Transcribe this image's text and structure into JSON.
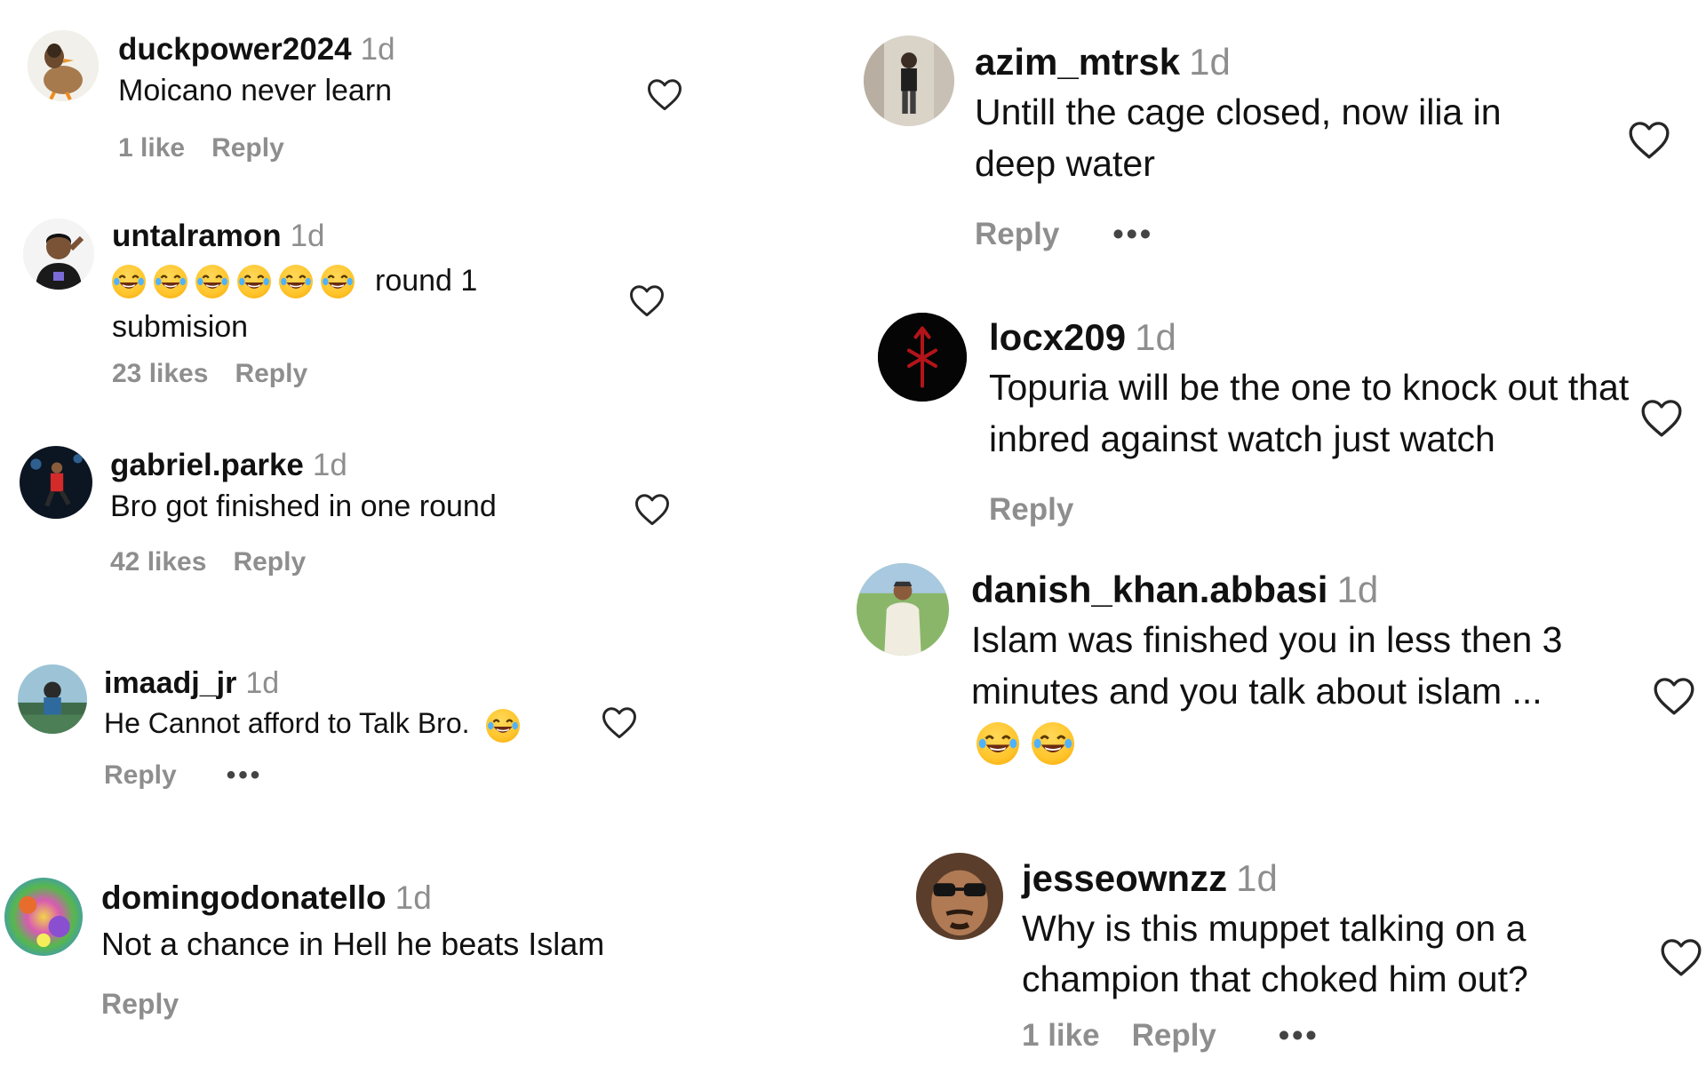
{
  "left_comments": [
    {
      "username": "duckpower2024",
      "time": "1d",
      "text": "Moicano never learn",
      "likes": "1 like",
      "reply": "Reply"
    },
    {
      "username": "untalramon",
      "time": "1d",
      "emoji_count": 6,
      "text_after_emoji": "round 1",
      "text_line2": "submision",
      "likes": "23 likes",
      "reply": "Reply"
    },
    {
      "username": "gabriel.parke",
      "time": "1d",
      "text": "Bro got finished in one round",
      "likes": "42 likes",
      "reply": "Reply"
    },
    {
      "username": "imaadj_jr",
      "time": "1d",
      "text": "He Cannot afford to Talk Bro.",
      "reply": "Reply",
      "more": "•••"
    },
    {
      "username": "domingodonatello",
      "time": "1d",
      "text": "Not a chance in Hell he beats Islam",
      "reply": "Reply"
    }
  ],
  "right_comments": [
    {
      "username": "azim_mtrsk",
      "time": "1d",
      "text": "Untill the cage closed, now ilia in deep water",
      "reply": "Reply",
      "more": "•••"
    },
    {
      "username": "locx209",
      "time": "1d",
      "text": "Topuria will be the one to knock out that inbred against watch just watch",
      "reply": "Reply"
    },
    {
      "username": "danish_khan.abbasi",
      "time": "1d",
      "text": "Islam was finished you in less then 3 minutes and you talk about islam ...",
      "emoji_count": 2
    },
    {
      "username": "jesseownzz",
      "time": "1d",
      "text": "Why is this muppet talking on a champion that choked him out?",
      "likes": "1 like",
      "reply": "Reply",
      "more": "•••"
    }
  ],
  "icons": {
    "like": "heart-outline-icon",
    "emoji": "face-with-tears-of-joy-icon",
    "more": "more-horizontal-icon"
  },
  "colors": {
    "text": "#111111",
    "muted": "#8e8e8e",
    "background": "#ffffff"
  }
}
